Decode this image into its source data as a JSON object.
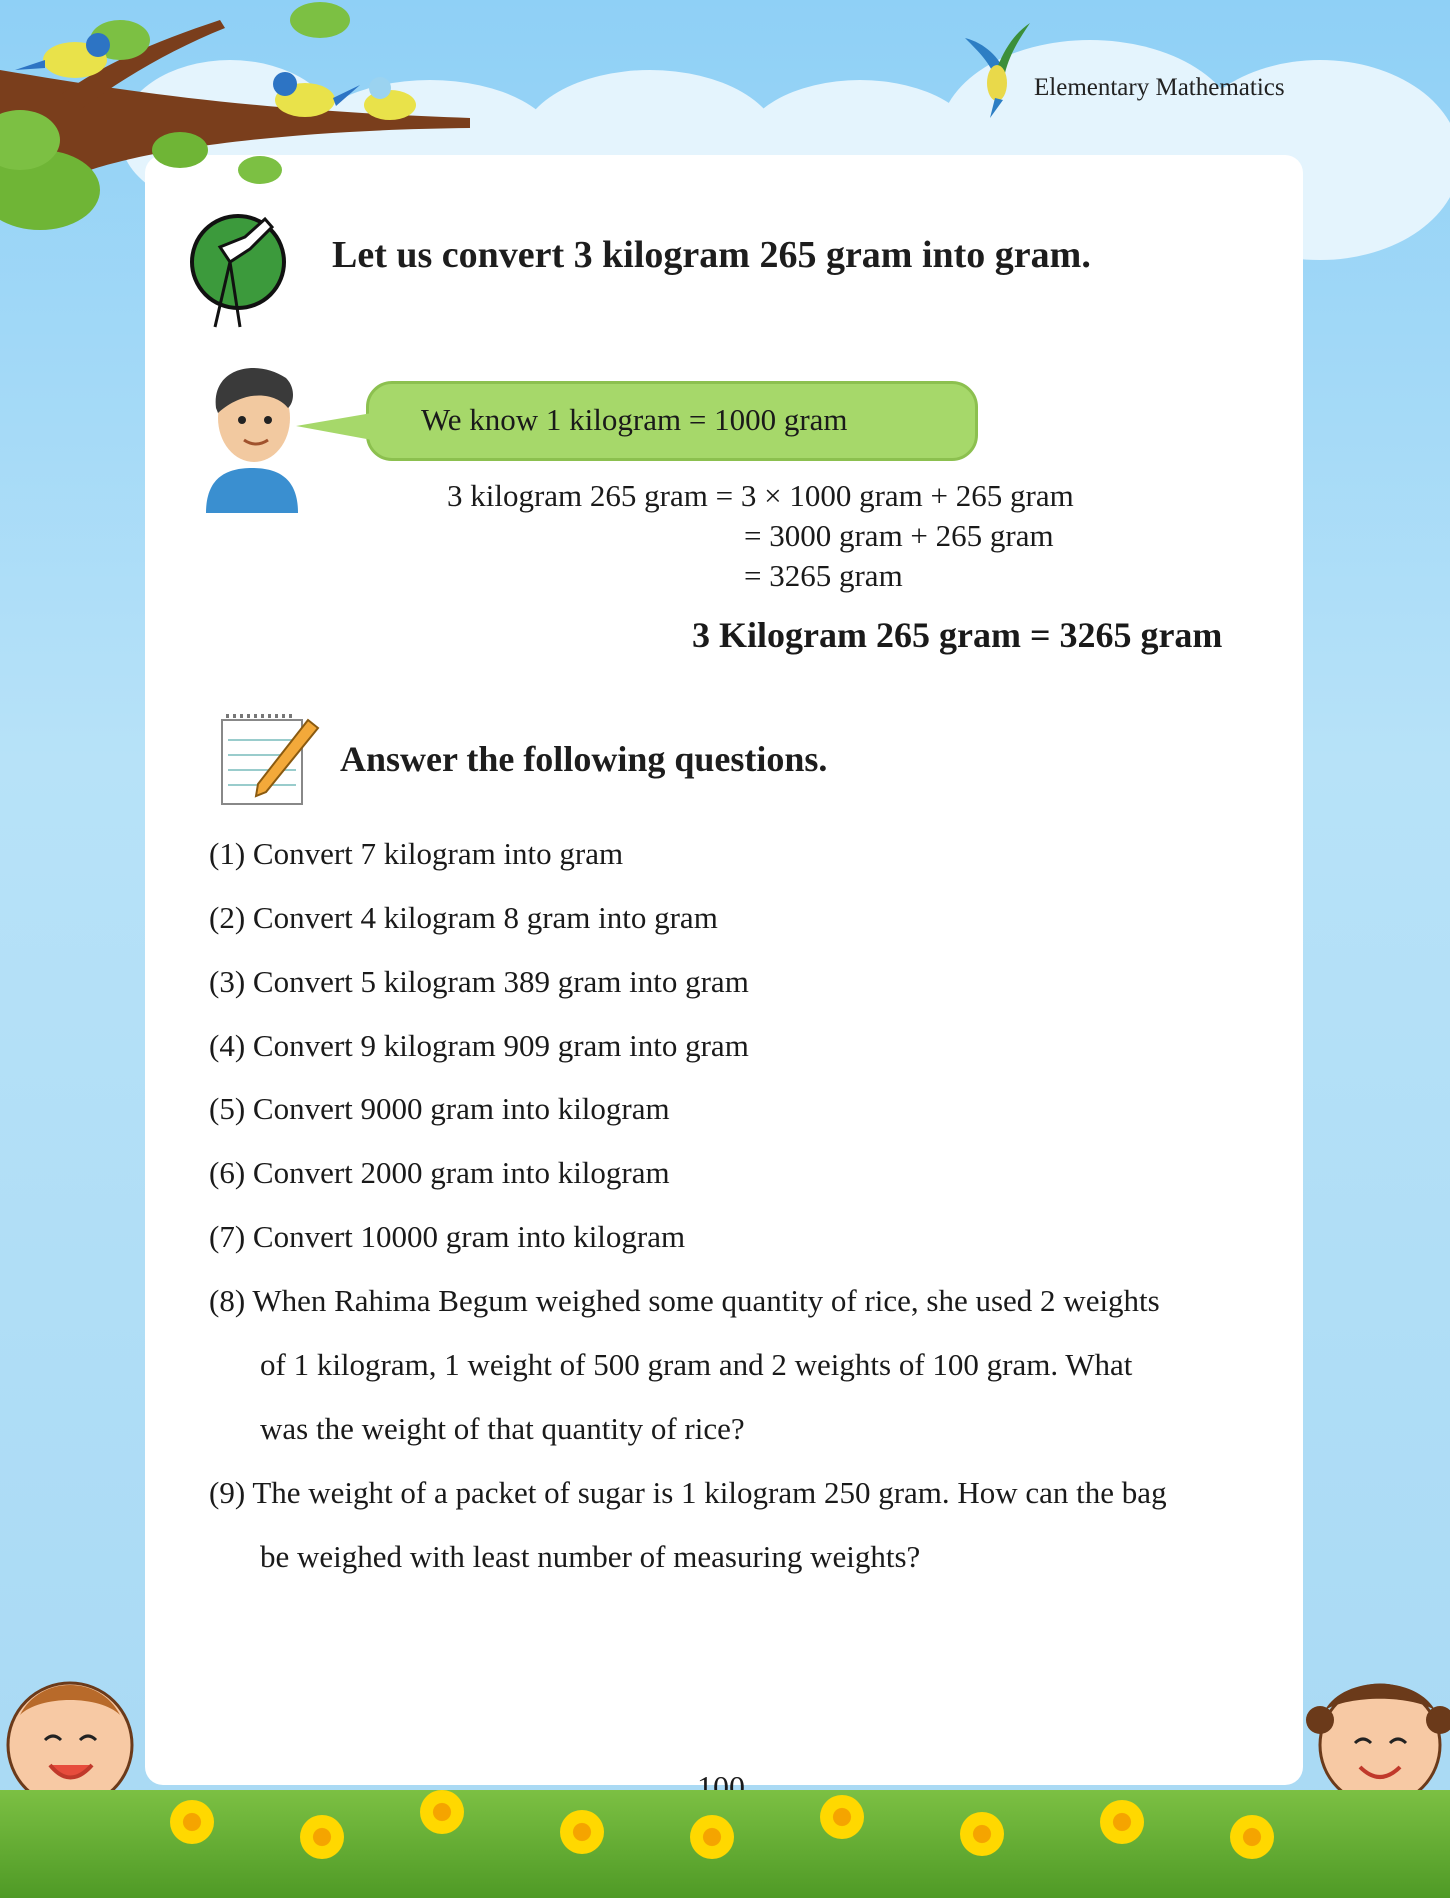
{
  "header": {
    "book_title": "Elementary Mathematics"
  },
  "section1": {
    "title": "Let us convert 3 kilogram 265 gram into gram.",
    "bubble": "We know 1 kilogram = 1000 gram",
    "calc_line1": "3 kilogram 265 gram = 3 × 1000 gram + 265 gram",
    "calc_line2": "= 3000 gram + 265 gram",
    "calc_line3": "= 3265 gram",
    "result": "3 Kilogram 265 gram = 3265 gram"
  },
  "section2": {
    "title": "Answer the following questions.",
    "questions": [
      "(1) Convert 7 kilogram into gram",
      "(2) Convert 4 kilogram 8 gram into gram",
      "(3) Convert 5 kilogram 389 gram into gram",
      "(4) Convert 9 kilogram 909 gram into gram",
      "(5) Convert 9000 gram into kilogram",
      "(6) Convert 2000 gram into kilogram",
      "(7) Convert 10000 gram into kilogram",
      "(8) When Rahima Begum weighed some quantity of rice, she used 2 weights",
      "of 1 kilogram, 1 weight of 500 gram and 2 weights of 100 gram. What",
      "was the weight of that quantity of rice?",
      "(9) The weight of a packet of sugar is 1 kilogram 250 gram. How can the bag",
      "be weighed with least number of measuring weights?"
    ]
  },
  "footer": {
    "page_number": "100"
  }
}
